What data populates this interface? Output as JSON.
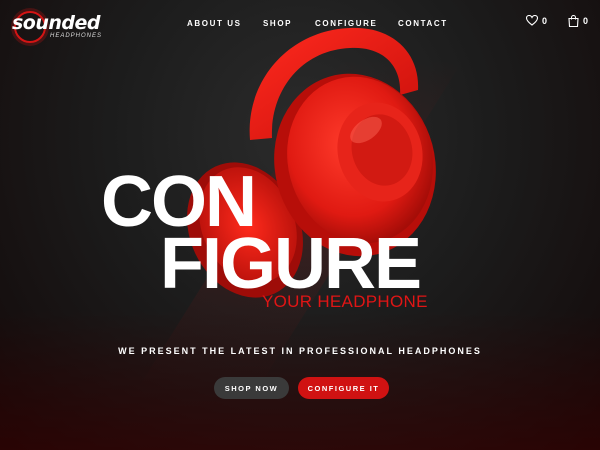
{
  "brand": {
    "name": "sounded",
    "subtitle": "HEADPHONES",
    "accent_color": "#d41414"
  },
  "nav": {
    "items": [
      {
        "label": "ABOUT US"
      },
      {
        "label": "SHOP"
      },
      {
        "label": "CONFIGURE"
      },
      {
        "label": "CONTACT"
      }
    ]
  },
  "header_icons": {
    "wishlist": {
      "icon": "heart-icon",
      "count": "0"
    },
    "cart": {
      "icon": "bag-icon",
      "count": "0"
    }
  },
  "hero": {
    "line1": "CON",
    "line2": "FIGURE",
    "subtitle": "YOUR HEADPHONE",
    "tagline": "WE PRESENT THE LATEST IN PROFESSIONAL HEADPHONES",
    "image_icon": "headphones-image"
  },
  "buttons": {
    "shop": "SHOP NOW",
    "configure": "CONFIGURE IT"
  },
  "colors": {
    "primary_red": "#d01212",
    "dark_button": "#3a3a3a",
    "background": "#1c1c1c"
  }
}
